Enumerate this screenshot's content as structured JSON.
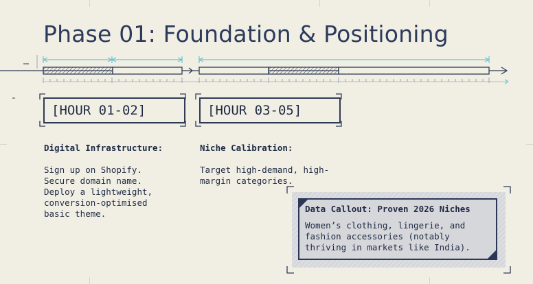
{
  "title": "Phase 01: Foundation & Positioning",
  "phases": [
    {
      "hour_label": "[HOUR 01-02]",
      "heading": "Digital Infrastructure:",
      "body": "Sign up on Shopify.\nSecure domain name.\nDeploy a lightweight,\nconversion-optimised\nbasic theme."
    },
    {
      "hour_label": "[HOUR 03-05]",
      "heading": "Niche Calibration:",
      "body": "Target high-demand, high-\nmargin categories."
    }
  ],
  "callout": {
    "heading": "Data Callout: Proven 2026 Niches",
    "body": "Women’s clothing, lingerie, and fashion accessories (notably thriving in markets like India)."
  },
  "colors": {
    "background": "#f1efe4",
    "ink": "#2f3a55",
    "accent": "#6fc3d3"
  }
}
